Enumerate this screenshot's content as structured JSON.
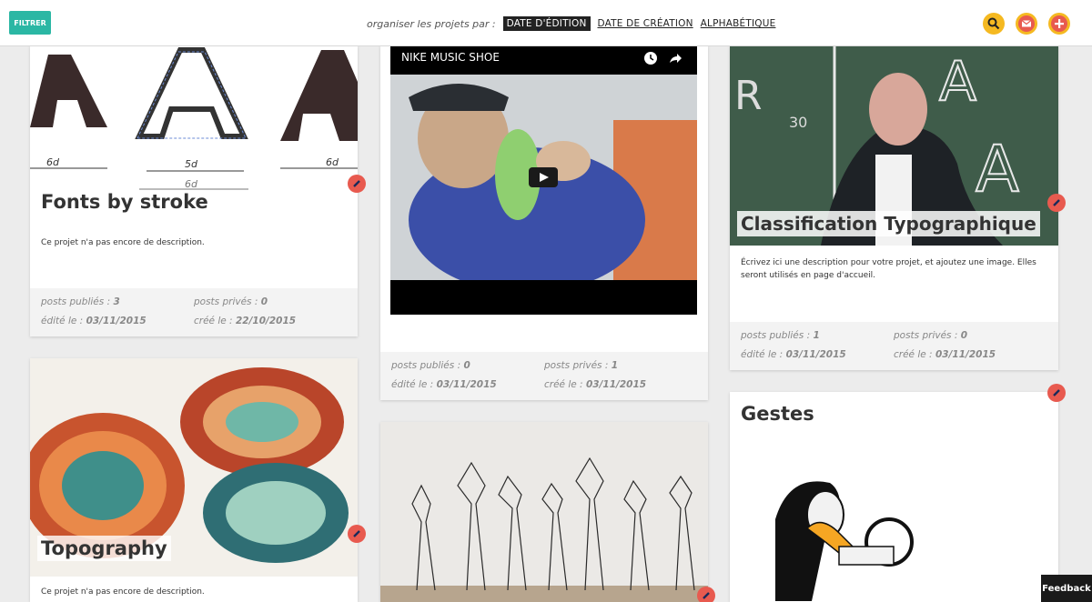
{
  "toolbar": {
    "filter_label": "FILTRER",
    "sort_label": "organiser les projets par :",
    "sort_options": [
      "DATE D'ÉDITION",
      "DATE DE CRÉATION",
      "ALPHABÉTIQUE"
    ],
    "icons": [
      "search-icon",
      "mail-icon",
      "plus-icon"
    ]
  },
  "colors": {
    "accent_teal": "#2bb7a4",
    "accent_yellow": "#f5b921",
    "accent_red": "#e85a4f"
  },
  "meta_labels": {
    "posts_published": "posts publiés :",
    "posts_private": "posts privés :",
    "edited": "édité le :",
    "created": "créé le :"
  },
  "cards": [
    {
      "title": "Fonts by stroke",
      "description": "Ce projet n'a pas encore de description.",
      "posts_published": "3",
      "posts_private": "0",
      "edited": "03/11/2015",
      "created": "22/10/2015"
    },
    {
      "video_title": "NIKE MUSIC SHOE",
      "posts_published": "0",
      "posts_private": "1",
      "edited": "03/11/2015",
      "created": "03/11/2015"
    },
    {
      "title": "Classification Typographique",
      "description": "Écrivez ici une description pour votre projet, et ajoutez une image. Elles seront utilisés en page d'accueil.",
      "posts_published": "1",
      "posts_private": "0",
      "edited": "03/11/2015",
      "created": "03/11/2015"
    },
    {
      "title": "Topography",
      "description": "Ce projet n'a pas encore de description."
    },
    {
      "title": "Gestes"
    }
  ],
  "feedback_label": "Feedback"
}
